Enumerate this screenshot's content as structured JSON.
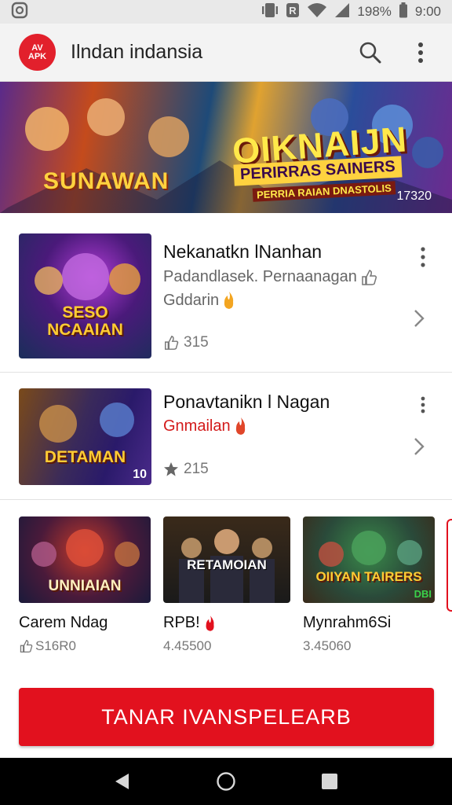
{
  "status_bar": {
    "battery": "198%",
    "time": "9:00",
    "icons": [
      "notification-icon",
      "vibrate-icon",
      "data-icon",
      "wifi-icon",
      "signal-icon",
      "battery-icon"
    ]
  },
  "app_bar": {
    "logo_lines": [
      "AV",
      "APK"
    ],
    "title": "Ilndan indansia",
    "icons": [
      "search-icon",
      "more-vert-icon"
    ]
  },
  "banner": {
    "title": "SUNAWAN",
    "heading": "OIKNAIJN",
    "sub": "PERIRRAS SAINERS",
    "tag": "PERRIA RAIAN DNASTOLIS",
    "corner": "17320"
  },
  "games": [
    {
      "title": "Nekanatkn lNanhan",
      "subtitle": "Padandlasek. Pernaanagan",
      "subtitle_icon": "thumbs-up-icon",
      "genre": "Gddarin",
      "genre_icon": "fire-icon",
      "rating_icon": "thumbs-up-icon",
      "rating": "315",
      "thumb_text": "SESO NCAAIAN"
    },
    {
      "title": "Ponavtanikn l Nagan",
      "genre": "Gnmailan",
      "genre_icon": "fire-icon",
      "rating_icon": "star-icon",
      "rating": "215",
      "thumb_text": "DETAMAN",
      "thumb_badge": "10"
    }
  ],
  "featured": [
    {
      "name": "Carem Ndag",
      "icon": "thumbs-up-icon",
      "count": "S16R0",
      "thumb_text": "UNNIAIAN"
    },
    {
      "name": "RPB!",
      "name_icon": "fire-icon",
      "count": "4.45500",
      "thumb_text": "RETAMOIAN"
    },
    {
      "name": "Mynrahm6Si",
      "count": "3.45060",
      "thumb_text": "OIIYAN TAIRERS",
      "thumb_badge": "DBI"
    }
  ],
  "cta": {
    "label": "TANAR IVANSPELEARB"
  },
  "nav_bar": {
    "icons": [
      "back-icon",
      "home-icon",
      "recents-icon"
    ]
  },
  "colors": {
    "accent": "#e2111e",
    "status_bar": "#e9e9e9",
    "app_bar": "#f3f3f3"
  }
}
